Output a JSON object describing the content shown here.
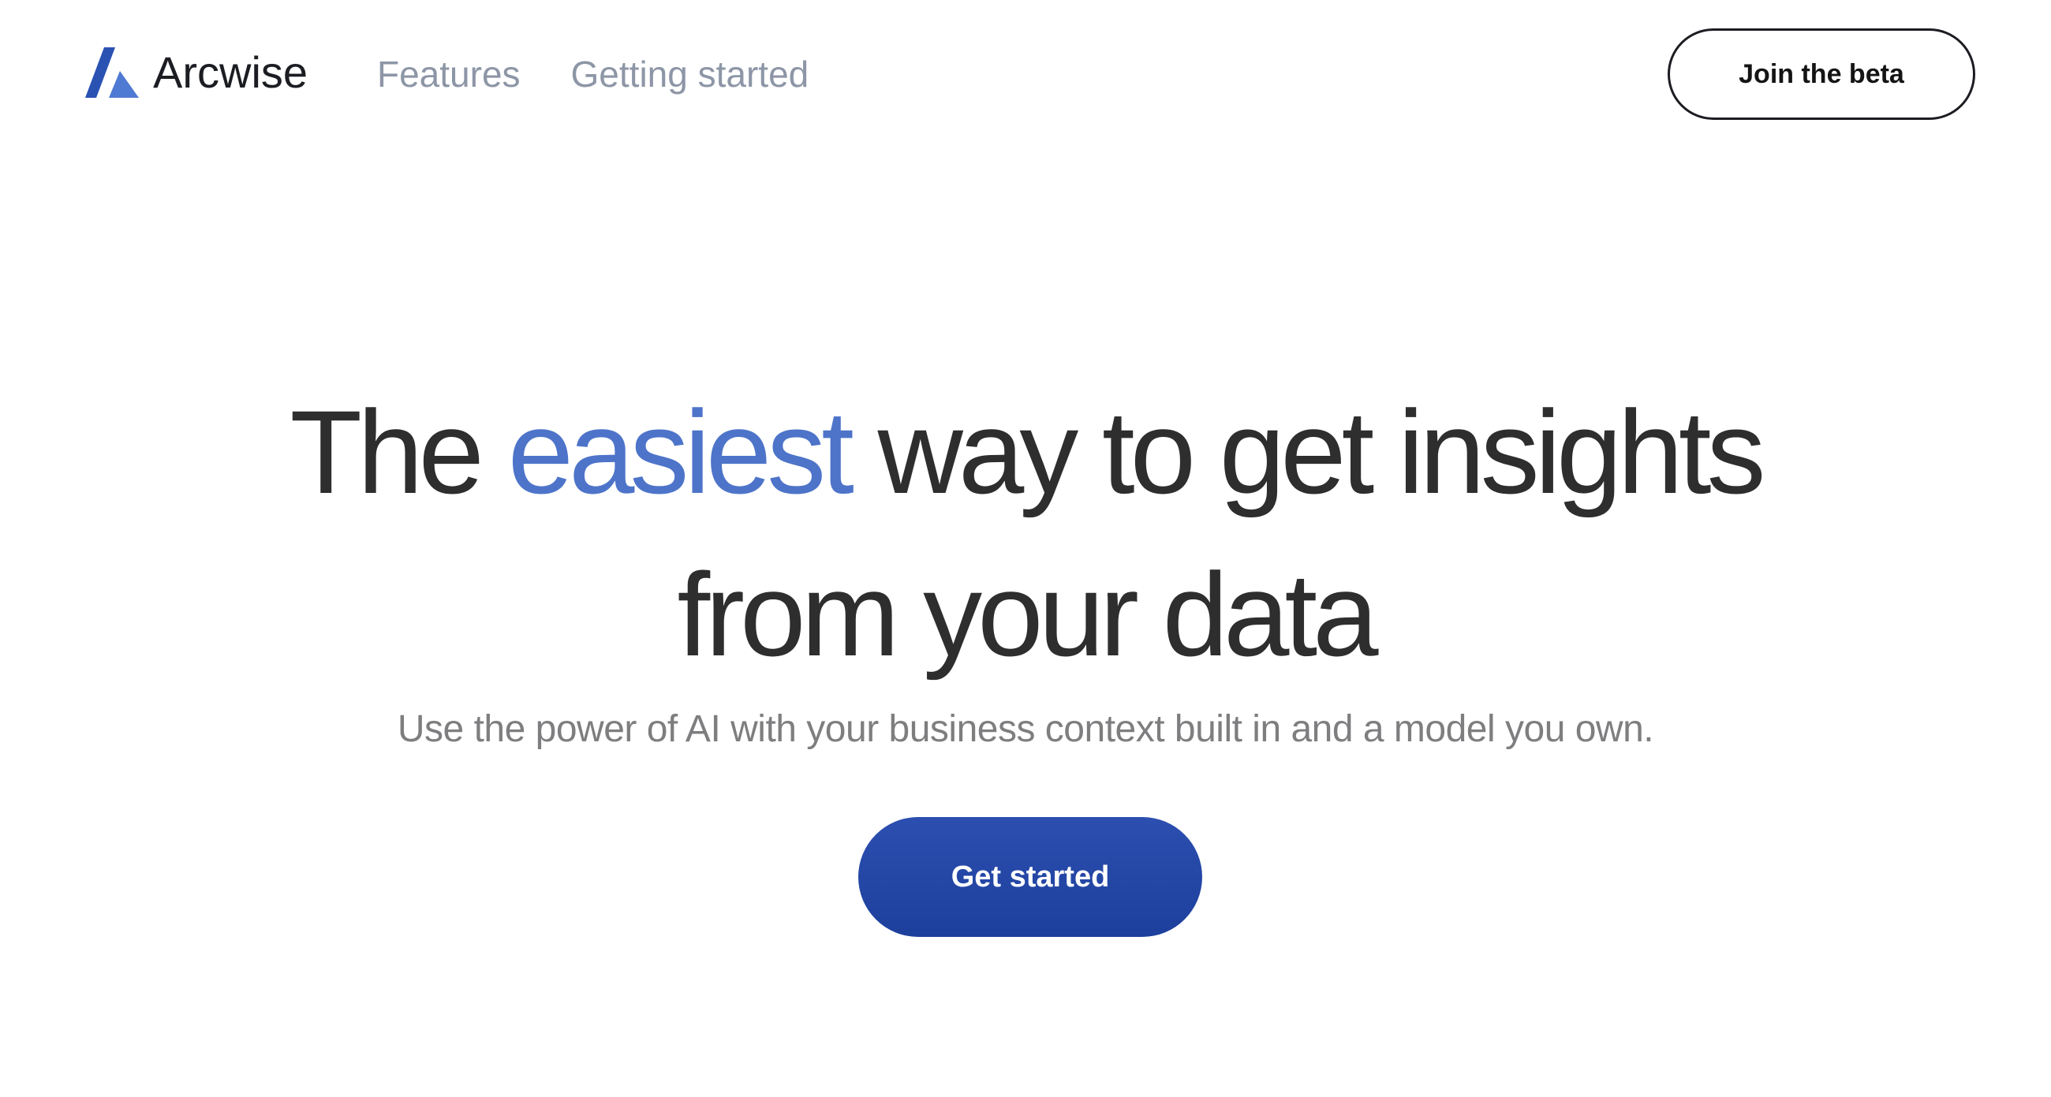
{
  "brand": {
    "name": "Arcwise",
    "logo_icon": "arcwise-logo-icon",
    "logo_colors": [
      "#2a52b3",
      "#4f7ad3"
    ]
  },
  "nav": {
    "items": [
      {
        "label": "Features"
      },
      {
        "label": "Getting started"
      }
    ]
  },
  "header": {
    "join_label": "Join the beta"
  },
  "hero": {
    "title_before": "The ",
    "title_accent": "easiest",
    "title_after_line1": " way to get insights",
    "title_line2": "from your data",
    "subtitle": "Use the power of AI with your business context built in and a model you own.",
    "cta_label": "Get started"
  },
  "colors": {
    "accent": "#4d74c9",
    "cta_background": "#2447a8",
    "heading_text": "#2e2e2e",
    "nav_text": "#8d96a6"
  }
}
